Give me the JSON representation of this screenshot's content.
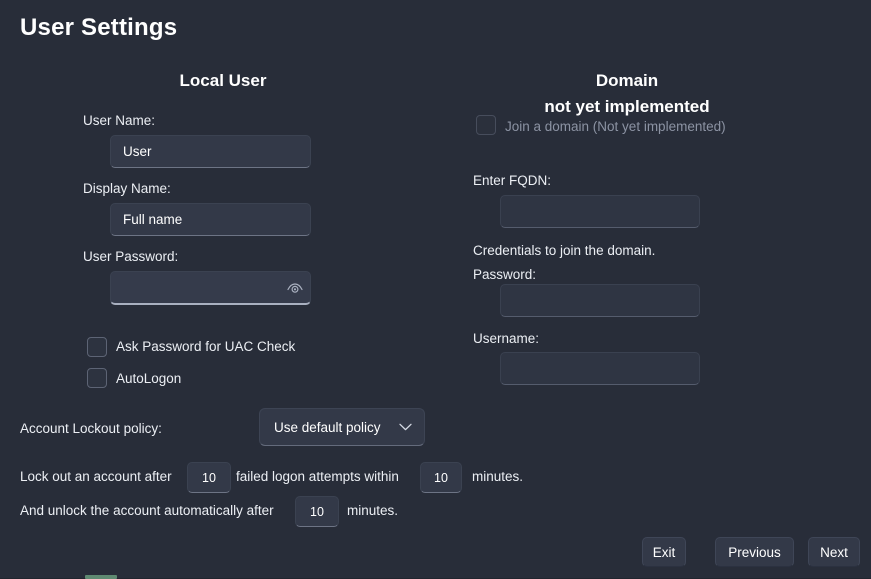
{
  "window": {
    "title": "User Settings",
    "background_color": "#282d39",
    "accent_text_color": "#ffffff"
  },
  "local_panel": {
    "heading": "Local User",
    "user_name": {
      "label": "User Name:",
      "value": "User",
      "placeholder": "User"
    },
    "display_name": {
      "label": "Display Name:",
      "value": "Full name",
      "placeholder": "Full name"
    },
    "user_password": {
      "label": "User Password:",
      "value": "",
      "placeholder": "",
      "reveal_icon": "eye-icon"
    },
    "checkboxes": [
      {
        "label": "Ask Password for UAC Check",
        "checked": false,
        "disabled": false
      },
      {
        "label": "AutoLogon",
        "checked": false,
        "disabled": false
      }
    ],
    "lockout_policy": {
      "label": "Account Lockout policy:",
      "selected": "Use default policy",
      "options": [
        "Use default policy"
      ],
      "chevron_icon": "chevron-down-icon"
    },
    "lockout_rule": {
      "text_before": "Lock out an account after",
      "attempts_value": "10",
      "text_middle": "failed logon attempts within",
      "window_value": "10",
      "text_after": "minutes."
    },
    "unlock_rule": {
      "text_before": "And unlock the account automatically after",
      "minutes_value": "10",
      "text_after": "minutes."
    }
  },
  "domain_panel": {
    "heading": "Domain",
    "subheading": "not yet implemented",
    "join_checkbox": {
      "label": "Join a domain (Not yet implemented)",
      "checked": false,
      "disabled": true
    },
    "fqdn": {
      "label": "Enter FQDN:",
      "value": "",
      "placeholder": ""
    },
    "credentials_note": "Credentials to join the domain.",
    "password": {
      "label": "Password:",
      "value": "",
      "placeholder": ""
    },
    "username": {
      "label": "Username:",
      "value": "",
      "placeholder": ""
    }
  },
  "footer": {
    "exit_label": "Exit",
    "previous_label": "Previous",
    "next_label": "Next"
  }
}
